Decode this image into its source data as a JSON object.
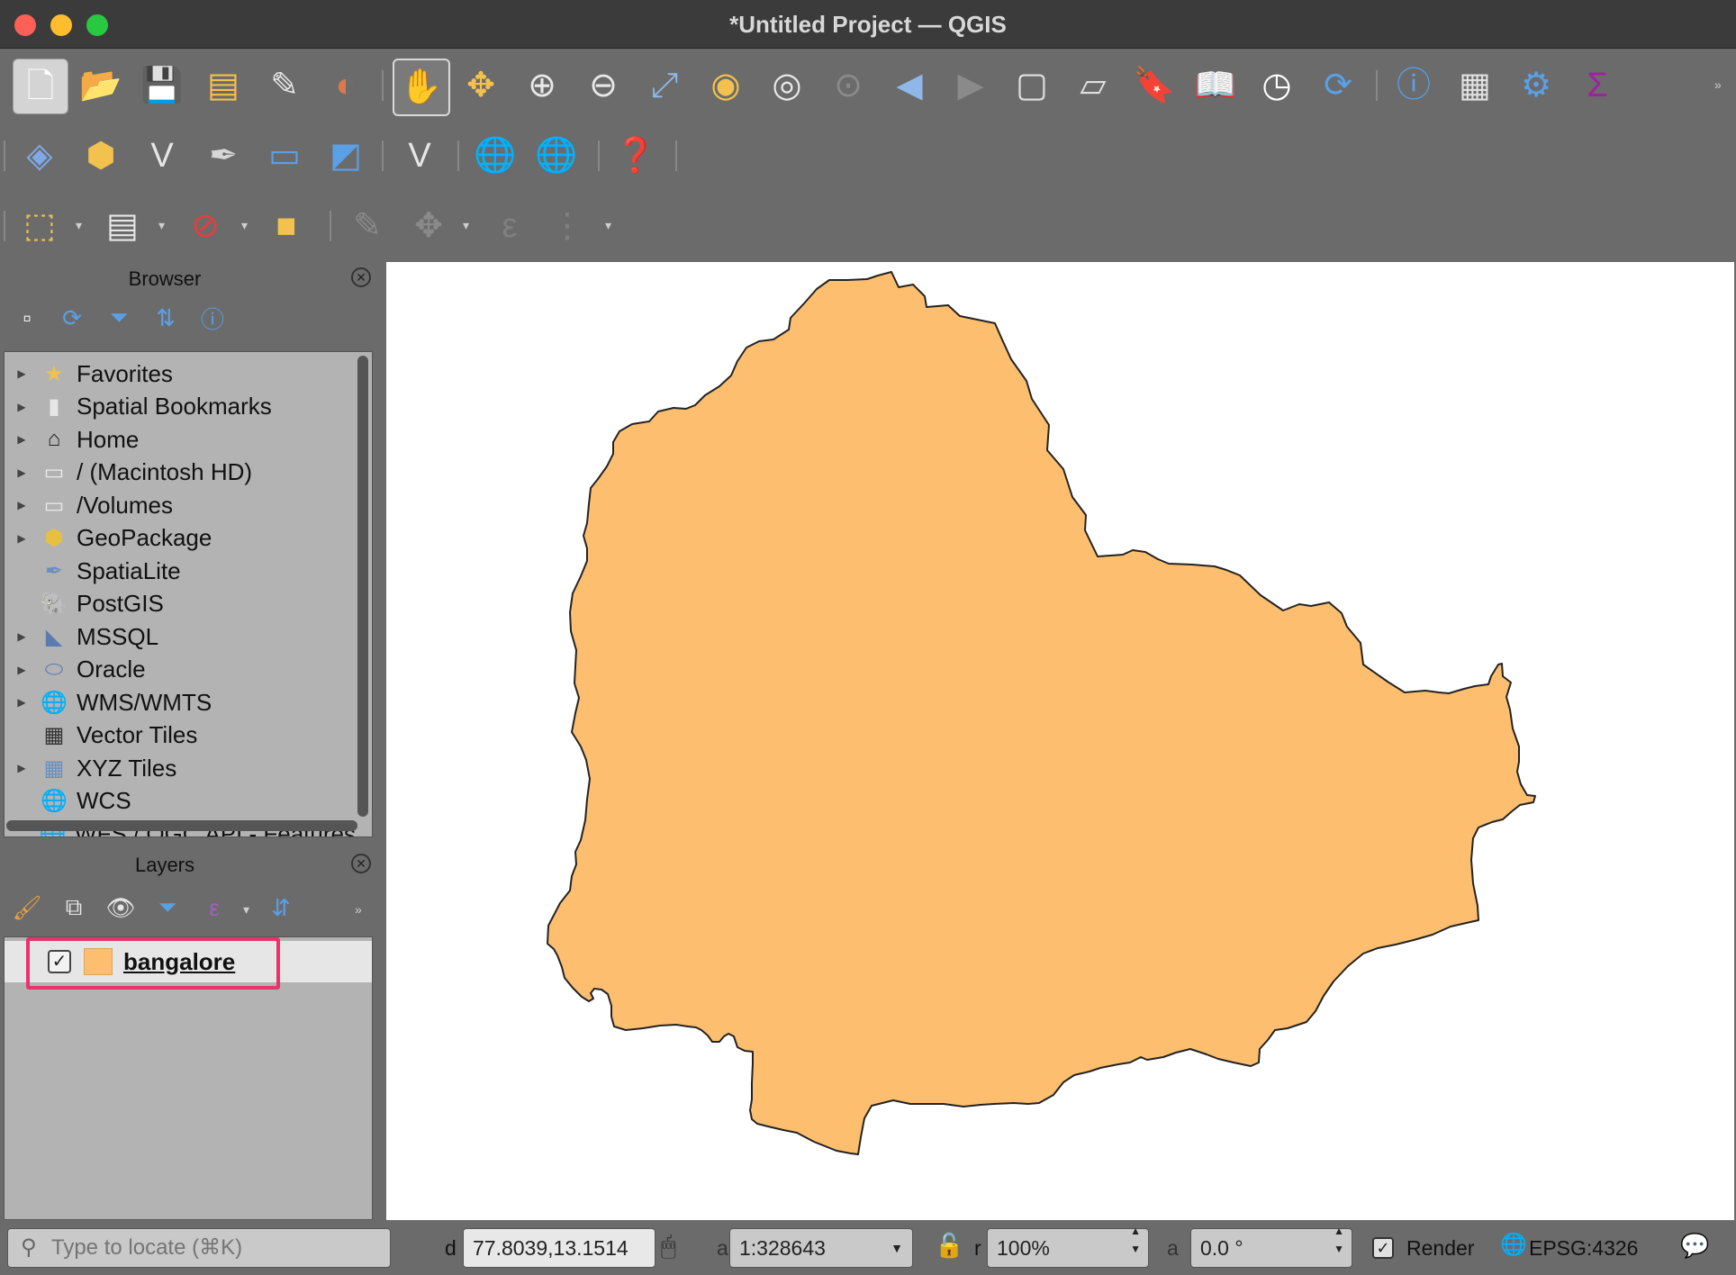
{
  "window": {
    "title": "*Untitled Project — QGIS"
  },
  "toolbar_icons": {
    "row1": [
      "new-project-icon",
      "open-project-icon",
      "save-project-icon",
      "new-print-layout-icon",
      "style-manager-icon",
      "label-tool-icon",
      "pan-icon",
      "pan-to-selection-icon",
      "zoom-in-icon",
      "zoom-out-icon",
      "zoom-full-icon",
      "zoom-to-selection-icon",
      "zoom-to-layer-icon",
      "zoom-native-icon",
      "zoom-last-icon",
      "zoom-next-icon",
      "new-map-view-icon",
      "new-3d-map-icon",
      "new-bookmark-icon",
      "show-bookmarks-icon",
      "temporal-controller-icon",
      "refresh-icon",
      "identify-icon",
      "attribute-table-icon",
      "processing-gear-icon",
      "statistics-sigma-icon"
    ],
    "row2": [
      "data-source-manager-icon",
      "new-geopackage-icon",
      "new-shapefile-icon",
      "new-spatialite-icon",
      "new-temporary-layer-icon",
      "new-virtual-layer-icon",
      "digitize-vertex-icon",
      "add-wms-icon",
      "metasearch-icon",
      "help-icon"
    ],
    "row3": [
      "select-features-icon",
      "select-by-value-icon",
      "deselect-icon",
      "select-by-location-icon",
      "edit-pencil-icon",
      "vertex-tool-icon",
      "expression-icon",
      "field-calculator-icon"
    ]
  },
  "browser": {
    "title": "Browser",
    "items": [
      {
        "label": "Favorites",
        "icon": "star-icon",
        "expandable": true
      },
      {
        "label": "Spatial Bookmarks",
        "icon": "bookmark-icon",
        "expandable": true
      },
      {
        "label": "Home",
        "icon": "home-icon",
        "expandable": true
      },
      {
        "label": "/ (Macintosh HD)",
        "icon": "folder-icon",
        "expandable": true
      },
      {
        "label": "/Volumes",
        "icon": "folder-icon",
        "expandable": true
      },
      {
        "label": "GeoPackage",
        "icon": "geopackage-icon",
        "expandable": true
      },
      {
        "label": "SpatiaLite",
        "icon": "spatialite-icon",
        "expandable": false
      },
      {
        "label": "PostGIS",
        "icon": "postgis-elephant-icon",
        "expandable": false
      },
      {
        "label": "MSSQL",
        "icon": "mssql-icon",
        "expandable": true
      },
      {
        "label": "Oracle",
        "icon": "oracle-icon",
        "expandable": true
      },
      {
        "label": "WMS/WMTS",
        "icon": "wms-globe-icon",
        "expandable": true
      },
      {
        "label": "Vector Tiles",
        "icon": "vector-tiles-grid-icon",
        "expandable": false
      },
      {
        "label": "XYZ Tiles",
        "icon": "xyz-tiles-grid-icon",
        "expandable": true
      },
      {
        "label": "WCS",
        "icon": "wcs-globe-icon",
        "expandable": false
      },
      {
        "label": "WFS / OGC API - Features",
        "icon": "wfs-globe-icon",
        "expandable": false
      }
    ]
  },
  "layers": {
    "title": "Layers",
    "items": [
      {
        "label": "bangalore",
        "checked": true,
        "swatch_color": "#fdbf6f"
      }
    ]
  },
  "map": {
    "fill_color": "#fdbf6f",
    "stroke_color": "#232323"
  },
  "status": {
    "locator_placeholder": "Type to locate (⌘K)",
    "coordinate_label": "d",
    "coordinate": "77.8039,13.1514",
    "scale_label": "a",
    "scale": "1:328643",
    "magnifier_label": "r",
    "magnifier": "100%",
    "rotation_label": "a",
    "rotation": "0.0 °",
    "render_label": "Render",
    "render_checked": true,
    "crs": "EPSG:4326"
  },
  "highlight_color": "#e8336d"
}
